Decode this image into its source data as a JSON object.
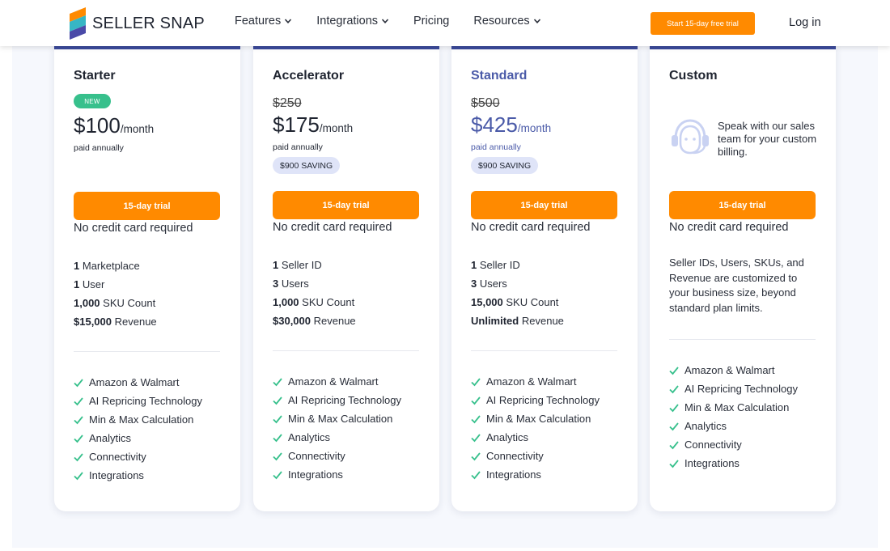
{
  "header": {
    "brand": "SELLER SNAP",
    "nav": [
      {
        "label": "Features",
        "has_dropdown": true
      },
      {
        "label": "Integrations",
        "has_dropdown": true
      },
      {
        "label": "Pricing",
        "has_dropdown": false
      },
      {
        "label": "Resources",
        "has_dropdown": true
      }
    ],
    "cta_label": "Start 15-day free trial",
    "login_label": "Log in"
  },
  "colors": {
    "accent_orange": "#ff8a00",
    "brand_blue": "#3c4b9c",
    "accent_blue_text": "#4a5aa8",
    "new_badge_green": "#37c08c",
    "check_green": "#37c08c",
    "saving_badge_bg": "#dfe4f8"
  },
  "plans": [
    {
      "name": "Starter",
      "badge": "NEW",
      "price": "$100",
      "period": "/month",
      "billing": "paid annually",
      "trial_label": "15-day trial",
      "no_cc": "No credit card required",
      "limits": [
        {
          "value": "1",
          "label": "Marketplace"
        },
        {
          "value": "1",
          "label": "User"
        },
        {
          "value": "1,000",
          "label": "SKU Count"
        },
        {
          "value": "$15,000",
          "label": "Revenue"
        }
      ],
      "features": [
        "Amazon & Walmart",
        "AI Repricing Technology",
        "Min & Max Calculation",
        "Analytics",
        "Connectivity",
        "Integrations"
      ]
    },
    {
      "name": "Accelerator",
      "old_price": "$250",
      "price": "$175",
      "period": "/month",
      "billing": "paid annually",
      "saving": "$900 SAVING",
      "trial_label": "15-day trial",
      "no_cc": "No credit card required",
      "limits": [
        {
          "value": "1",
          "label": "Seller ID"
        },
        {
          "value": "3",
          "label": "Users"
        },
        {
          "value": "1,000",
          "label": "SKU Count"
        },
        {
          "value": "$30,000",
          "label": "Revenue"
        }
      ],
      "features": [
        "Amazon & Walmart",
        "AI Repricing Technology",
        "Min & Max Calculation",
        "Analytics",
        "Connectivity",
        "Integrations"
      ]
    },
    {
      "name": "Standard",
      "old_price": "$500",
      "price": "$425",
      "period": "/month",
      "billing": "paid annually",
      "saving": "$900 SAVING",
      "trial_label": "15-day trial",
      "no_cc": "No credit card required",
      "limits": [
        {
          "value": "1",
          "label": "Seller ID"
        },
        {
          "value": "3",
          "label": "Users"
        },
        {
          "value": "15,000",
          "label": "SKU Count"
        },
        {
          "value": "Unlimited",
          "label": "Revenue"
        }
      ],
      "features": [
        "Amazon & Walmart",
        "AI Repricing Technology",
        "Min & Max Calculation",
        "Analytics",
        "Connectivity",
        "Integrations"
      ]
    },
    {
      "name": "Custom",
      "speak_text": "Speak with our sales team for your custom billing.",
      "trial_label": "15-day trial",
      "no_cc": "No credit card required",
      "description": "Seller IDs, Users, SKUs, and Revenue are customized to your business size, beyond standard plan limits.",
      "features": [
        "Amazon & Walmart",
        "AI Repricing Technology",
        "Min & Max Calculation",
        "Analytics",
        "Connectivity",
        "Integrations"
      ]
    }
  ],
  "icons": {
    "logo": "seller-snap-logo-icon",
    "dropdown": "chevron-down-icon",
    "check": "check-icon",
    "support": "headset-support-icon"
  }
}
